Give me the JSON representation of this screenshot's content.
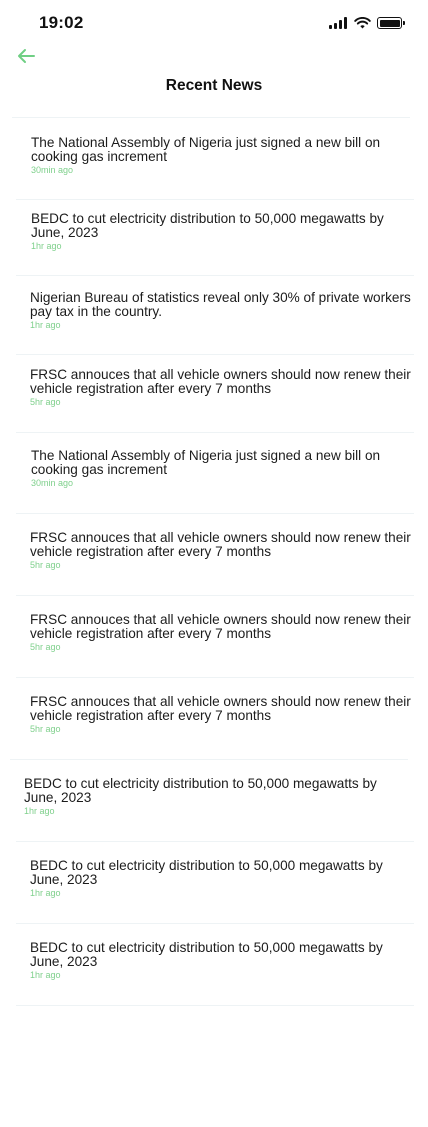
{
  "status_bar": {
    "time": "19:02"
  },
  "header": {
    "title": "Recent News"
  },
  "colors": {
    "accent": "#6fcf84",
    "divider": "#eef3f5"
  },
  "icons": {
    "back": "arrow-left-icon",
    "signal": "cellular-signal-icon",
    "wifi": "wifi-icon",
    "battery": "battery-icon"
  },
  "news": [
    {
      "headline": "The National Assembly of Nigeria just signed a new bill on cooking gas increment",
      "time": "30min ago"
    },
    {
      "headline": "BEDC to cut electricity distribution to 50,000 megawatts by June, 2023",
      "time": "1hr ago"
    },
    {
      "headline": "Nigerian Bureau of statistics reveal only 30% of private workers pay tax in the country.",
      "time": "1hr ago"
    },
    {
      "headline": "FRSC annouces that all vehicle owners should now renew their vehicle registration after every 7 months",
      "time": "5hr ago"
    },
    {
      "headline": "The National Assembly of Nigeria just signed a new bill on cooking gas increment",
      "time": "30min ago"
    },
    {
      "headline": "FRSC annouces that all vehicle owners should now renew their vehicle registration after every 7 months",
      "time": "5hr ago"
    },
    {
      "headline": "FRSC annouces that all vehicle owners should now renew their vehicle registration after every 7 months",
      "time": "5hr ago"
    },
    {
      "headline": "FRSC annouces that all vehicle owners should now renew their vehicle registration after every 7 months",
      "time": "5hr ago"
    },
    {
      "headline": "BEDC to cut electricity distribution to 50,000 megawatts by June, 2023",
      "time": "1hr ago"
    },
    {
      "headline": "BEDC to cut electricity distribution to 50,000 megawatts by June, 2023",
      "time": "1hr ago"
    },
    {
      "headline": "BEDC to cut electricity distribution to 50,000 megawatts by June, 2023",
      "time": "1hr ago"
    }
  ]
}
